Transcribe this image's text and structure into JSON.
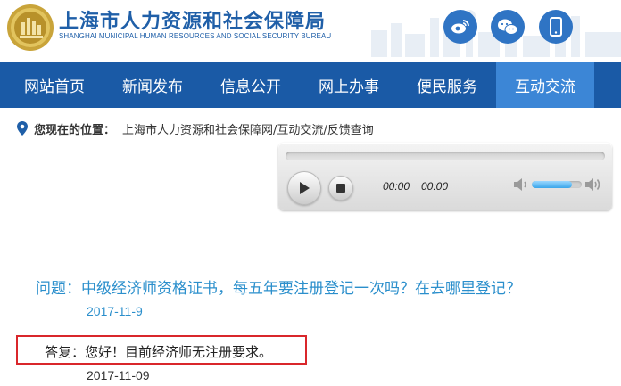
{
  "header": {
    "title": "上海市人力资源和社会保障局",
    "subtitle": "SHANGHAI MUNICIPAL HUMAN RESOURCES AND SOCIAL SECURITY BUREAU",
    "social_icons": [
      "weibo-icon",
      "wechat-icon",
      "mobile-icon"
    ],
    "brand_color": "#1f5fa8"
  },
  "nav": {
    "items": [
      {
        "label": "网站首页"
      },
      {
        "label": "新闻发布"
      },
      {
        "label": "信息公开"
      },
      {
        "label": "网上办事"
      },
      {
        "label": "便民服务"
      },
      {
        "label": "互动交流",
        "active": true
      }
    ],
    "bg_color": "#1a5aa6",
    "active_color": "#3c86d6"
  },
  "breadcrumb": {
    "prefix": "您现在的位置：",
    "items": [
      {
        "label": "上海市人力资源和社会保障网/"
      },
      {
        "label": "互动交流/"
      },
      {
        "label": "反馈查询"
      }
    ]
  },
  "player": {
    "current_time": "00:00",
    "total_time": "00:00",
    "volume_fraction": 0.8
  },
  "qa": {
    "question": "问题：中级经济师资格证书，每五年要注册登记一次吗？在去哪里登记？",
    "question_date": "2017-11-9",
    "answer": "答复：您好！目前经济师无注册要求。",
    "answer_date": "2017-11-09",
    "highlight_color": "#d9262b"
  }
}
